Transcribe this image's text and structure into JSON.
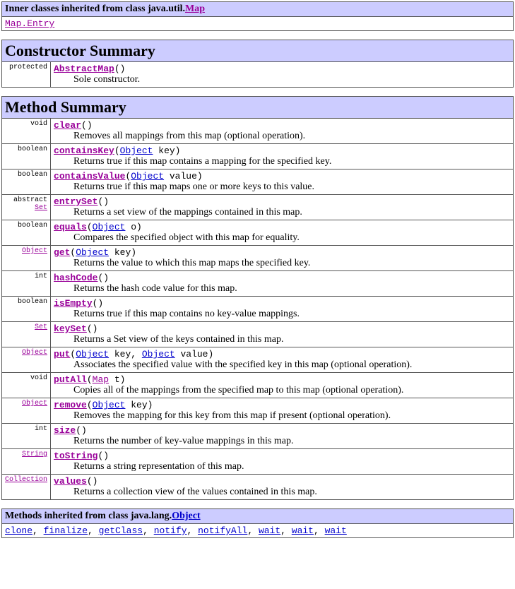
{
  "innerClasses": {
    "headerPrefix": "Inner classes inherited from class java.util.",
    "headerLink": "Map",
    "entryLink": "Map.Entry"
  },
  "constructor": {
    "header": "Constructor Summary",
    "rows": [
      {
        "modifier": "protected",
        "name": "AbstractMap",
        "afterName": "()",
        "desc": "Sole constructor."
      }
    ]
  },
  "methods": {
    "header": "Method Summary",
    "rows": [
      {
        "modifier": " void",
        "sig": [
          {
            "t": "link",
            "v": "clear"
          },
          {
            "t": "txt",
            "v": "()"
          }
        ],
        "desc": "Removes all mappings from this map (optional operation)."
      },
      {
        "modifier": " boolean",
        "sig": [
          {
            "t": "link",
            "v": "containsKey"
          },
          {
            "t": "txt",
            "v": "("
          },
          {
            "t": "blue",
            "v": "Object"
          },
          {
            "t": "txt",
            "v": " key)"
          }
        ],
        "desc": "Returns true if this map contains a mapping for the specified key."
      },
      {
        "modifier": " boolean",
        "sig": [
          {
            "t": "link",
            "v": "containsValue"
          },
          {
            "t": "txt",
            "v": "("
          },
          {
            "t": "blue",
            "v": "Object"
          },
          {
            "t": "txt",
            "v": " value)"
          }
        ],
        "desc": "Returns true if this map maps one or more keys to this value."
      },
      {
        "modifier": "abstract  ",
        "modLink": "Set",
        "sig": [
          {
            "t": "link",
            "v": "entrySet"
          },
          {
            "t": "txt",
            "v": "()"
          }
        ],
        "desc": "Returns a set view of the mappings contained in this map."
      },
      {
        "modifier": " boolean",
        "sig": [
          {
            "t": "link",
            "v": "equals"
          },
          {
            "t": "txt",
            "v": "("
          },
          {
            "t": "blue",
            "v": "Object"
          },
          {
            "t": "txt",
            "v": " o)"
          }
        ],
        "desc": "Compares the specified object with this map for equality."
      },
      {
        "modLink": "Object",
        "sig": [
          {
            "t": "link",
            "v": "get"
          },
          {
            "t": "txt",
            "v": "("
          },
          {
            "t": "blue",
            "v": "Object"
          },
          {
            "t": "txt",
            "v": " key)"
          }
        ],
        "desc": "Returns the value to which this map maps the specified key."
      },
      {
        "modifier": " int",
        "sig": [
          {
            "t": "link",
            "v": "hashCode"
          },
          {
            "t": "txt",
            "v": "()"
          }
        ],
        "desc": "Returns the hash code value for this map."
      },
      {
        "modifier": " boolean",
        "sig": [
          {
            "t": "link",
            "v": "isEmpty"
          },
          {
            "t": "txt",
            "v": "()"
          }
        ],
        "desc": "Returns true if this map contains no key-value mappings."
      },
      {
        "modLink": "Set",
        "sig": [
          {
            "t": "link",
            "v": "keySet"
          },
          {
            "t": "txt",
            "v": "()"
          }
        ],
        "desc": "Returns a Set view of the keys contained in this map."
      },
      {
        "modLink": "Object",
        "sig": [
          {
            "t": "link",
            "v": "put"
          },
          {
            "t": "txt",
            "v": "("
          },
          {
            "t": "blue",
            "v": "Object"
          },
          {
            "t": "txt",
            "v": " key, "
          },
          {
            "t": "blue",
            "v": "Object"
          },
          {
            "t": "txt",
            "v": " value)"
          }
        ],
        "desc": "Associates the specified value with the specified key in this map (optional operation)."
      },
      {
        "modifier": " void",
        "sig": [
          {
            "t": "link",
            "v": "putAll"
          },
          {
            "t": "txt",
            "v": "("
          },
          {
            "t": "link",
            "v": "Map"
          },
          {
            "t": "txt",
            "v": " t)"
          }
        ],
        "desc": "Copies all of the mappings from the specified map to this map (optional operation)."
      },
      {
        "modLink": "Object",
        "sig": [
          {
            "t": "link",
            "v": "remove"
          },
          {
            "t": "txt",
            "v": "("
          },
          {
            "t": "blue",
            "v": "Object"
          },
          {
            "t": "txt",
            "v": " key)"
          }
        ],
        "desc": "Removes the mapping for this key from this map if present (optional operation)."
      },
      {
        "modifier": " int",
        "sig": [
          {
            "t": "link",
            "v": "size"
          },
          {
            "t": "txt",
            "v": "()"
          }
        ],
        "desc": "Returns the number of key-value mappings in this map."
      },
      {
        "modLink": "String",
        "sig": [
          {
            "t": "link",
            "v": "toString"
          },
          {
            "t": "txt",
            "v": "()"
          }
        ],
        "desc": "Returns a string representation of this map."
      },
      {
        "modLink": "Collection",
        "sig": [
          {
            "t": "link",
            "v": "values"
          },
          {
            "t": "txt",
            "v": "()"
          }
        ],
        "desc": "Returns a collection view of the values contained in this map."
      }
    ]
  },
  "inherited": {
    "headerPrefix": "Methods inherited from class java.lang.",
    "headerLink": "Object",
    "items": [
      "clone",
      "finalize",
      "getClass",
      "notify",
      "notifyAll",
      "wait",
      "wait",
      "wait"
    ]
  }
}
